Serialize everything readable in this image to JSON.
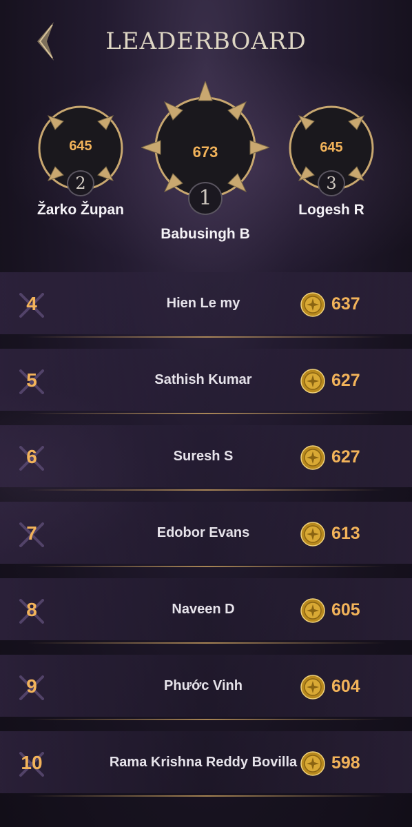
{
  "header": {
    "title": "LEADERBOARD"
  },
  "colors": {
    "accent_gold": "#f2b35a",
    "frame_gold": "#c9a870",
    "bg": "#1c1626"
  },
  "podium": {
    "first": {
      "rank": "1",
      "score": "673",
      "name": "Babusingh B"
    },
    "second": {
      "rank": "2",
      "score": "645",
      "name": "Žarko Župan"
    },
    "third": {
      "rank": "3",
      "score": "645",
      "name": "Logesh R"
    }
  },
  "rows": [
    {
      "rank": "4",
      "name": "Hien Le my",
      "score": "637",
      "icon": "gold-coin-icon"
    },
    {
      "rank": "5",
      "name": "Sathish Kumar",
      "score": "627",
      "icon": "gold-coin-icon"
    },
    {
      "rank": "6",
      "name": "Suresh S",
      "score": "627",
      "icon": "gold-coin-icon"
    },
    {
      "rank": "7",
      "name": "Edobor Evans",
      "score": "613",
      "icon": "gold-coin-icon"
    },
    {
      "rank": "8",
      "name": "Naveen D",
      "score": "605",
      "icon": "gold-coin-icon"
    },
    {
      "rank": "9",
      "name": "Phước Vinh",
      "score": "604",
      "icon": "gold-coin-icon"
    },
    {
      "rank": "10",
      "name": "Rama Krishna Reddy Bovilla",
      "score": "598",
      "icon": "gold-coin-icon"
    }
  ]
}
